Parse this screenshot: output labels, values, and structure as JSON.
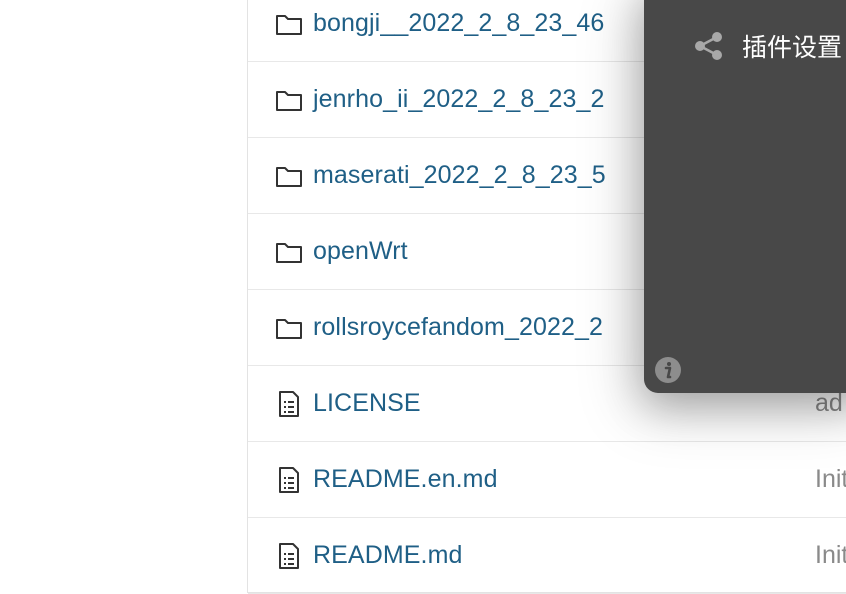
{
  "file_list": {
    "rows": [
      {
        "icon": "folder-icon",
        "name": "bongji__2022_2_8_23_46",
        "message": ""
      },
      {
        "icon": "folder-icon",
        "name": "jenrho_ii_2022_2_8_23_2",
        "message": ""
      },
      {
        "icon": "folder-icon",
        "name": "maserati_2022_2_8_23_5",
        "message": ""
      },
      {
        "icon": "folder-icon",
        "name": "openWrt",
        "message": ""
      },
      {
        "icon": "folder-icon",
        "name": "rollsroycefandom_2022_2",
        "message": ""
      },
      {
        "icon": "file-text-icon",
        "name": "LICENSE",
        "message": "ad"
      },
      {
        "icon": "file-text-icon",
        "name": "README.en.md",
        "message": "Init"
      },
      {
        "icon": "file-text-icon",
        "name": "README.md",
        "message": "Init"
      }
    ]
  },
  "popup": {
    "share_icon": "share-icon",
    "setting_label": "插件设置",
    "info_icon": "info-icon"
  },
  "colors": {
    "link": "#1f5f86",
    "popup_bg": "#484848",
    "muted": "#8a8a8a"
  }
}
